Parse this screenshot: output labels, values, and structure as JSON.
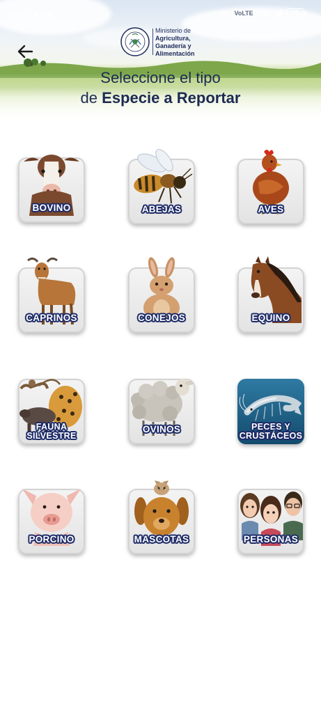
{
  "status_bar": {
    "carrier": "TIGO",
    "time": "5:26",
    "network_small": "4G",
    "volte": "VoLTE",
    "lte": "LTE",
    "battery": "72"
  },
  "header": {
    "ministry_lines": [
      "Ministerio de",
      "Agricultura,",
      "Ganadería y",
      "Alimentación"
    ],
    "title_line1": "Seleccione el tipo",
    "title_line2_prefix": "de ",
    "title_line2_strong": "Especie a Reportar"
  },
  "species": [
    {
      "id": "bovino",
      "label": "BOVINO",
      "icon": "cow-icon"
    },
    {
      "id": "abejas",
      "label": "ABEJAS",
      "icon": "bee-icon"
    },
    {
      "id": "aves",
      "label": "AVES",
      "icon": "chicken-icon"
    },
    {
      "id": "caprinos",
      "label": "CAPRINOS",
      "icon": "goat-icon"
    },
    {
      "id": "conejos",
      "label": "CONEJOS",
      "icon": "rabbit-icon"
    },
    {
      "id": "equino",
      "label": "EQUINO",
      "icon": "horse-icon"
    },
    {
      "id": "fauna-silvestre",
      "label": "FAUNA SILVESTRE",
      "icon": "wildlife-icon"
    },
    {
      "id": "ovinos",
      "label": "OVINOS",
      "icon": "sheep-icon"
    },
    {
      "id": "peces-crustaceos",
      "label": "PECES Y CRUSTÁCEOS",
      "icon": "shrimp-icon"
    },
    {
      "id": "porcino",
      "label": "PORCINO",
      "icon": "pig-icon"
    },
    {
      "id": "mascotas",
      "label": "MASCOTAS",
      "icon": "pets-icon"
    },
    {
      "id": "personas",
      "label": "PERSONAS",
      "icon": "people-icon"
    }
  ]
}
